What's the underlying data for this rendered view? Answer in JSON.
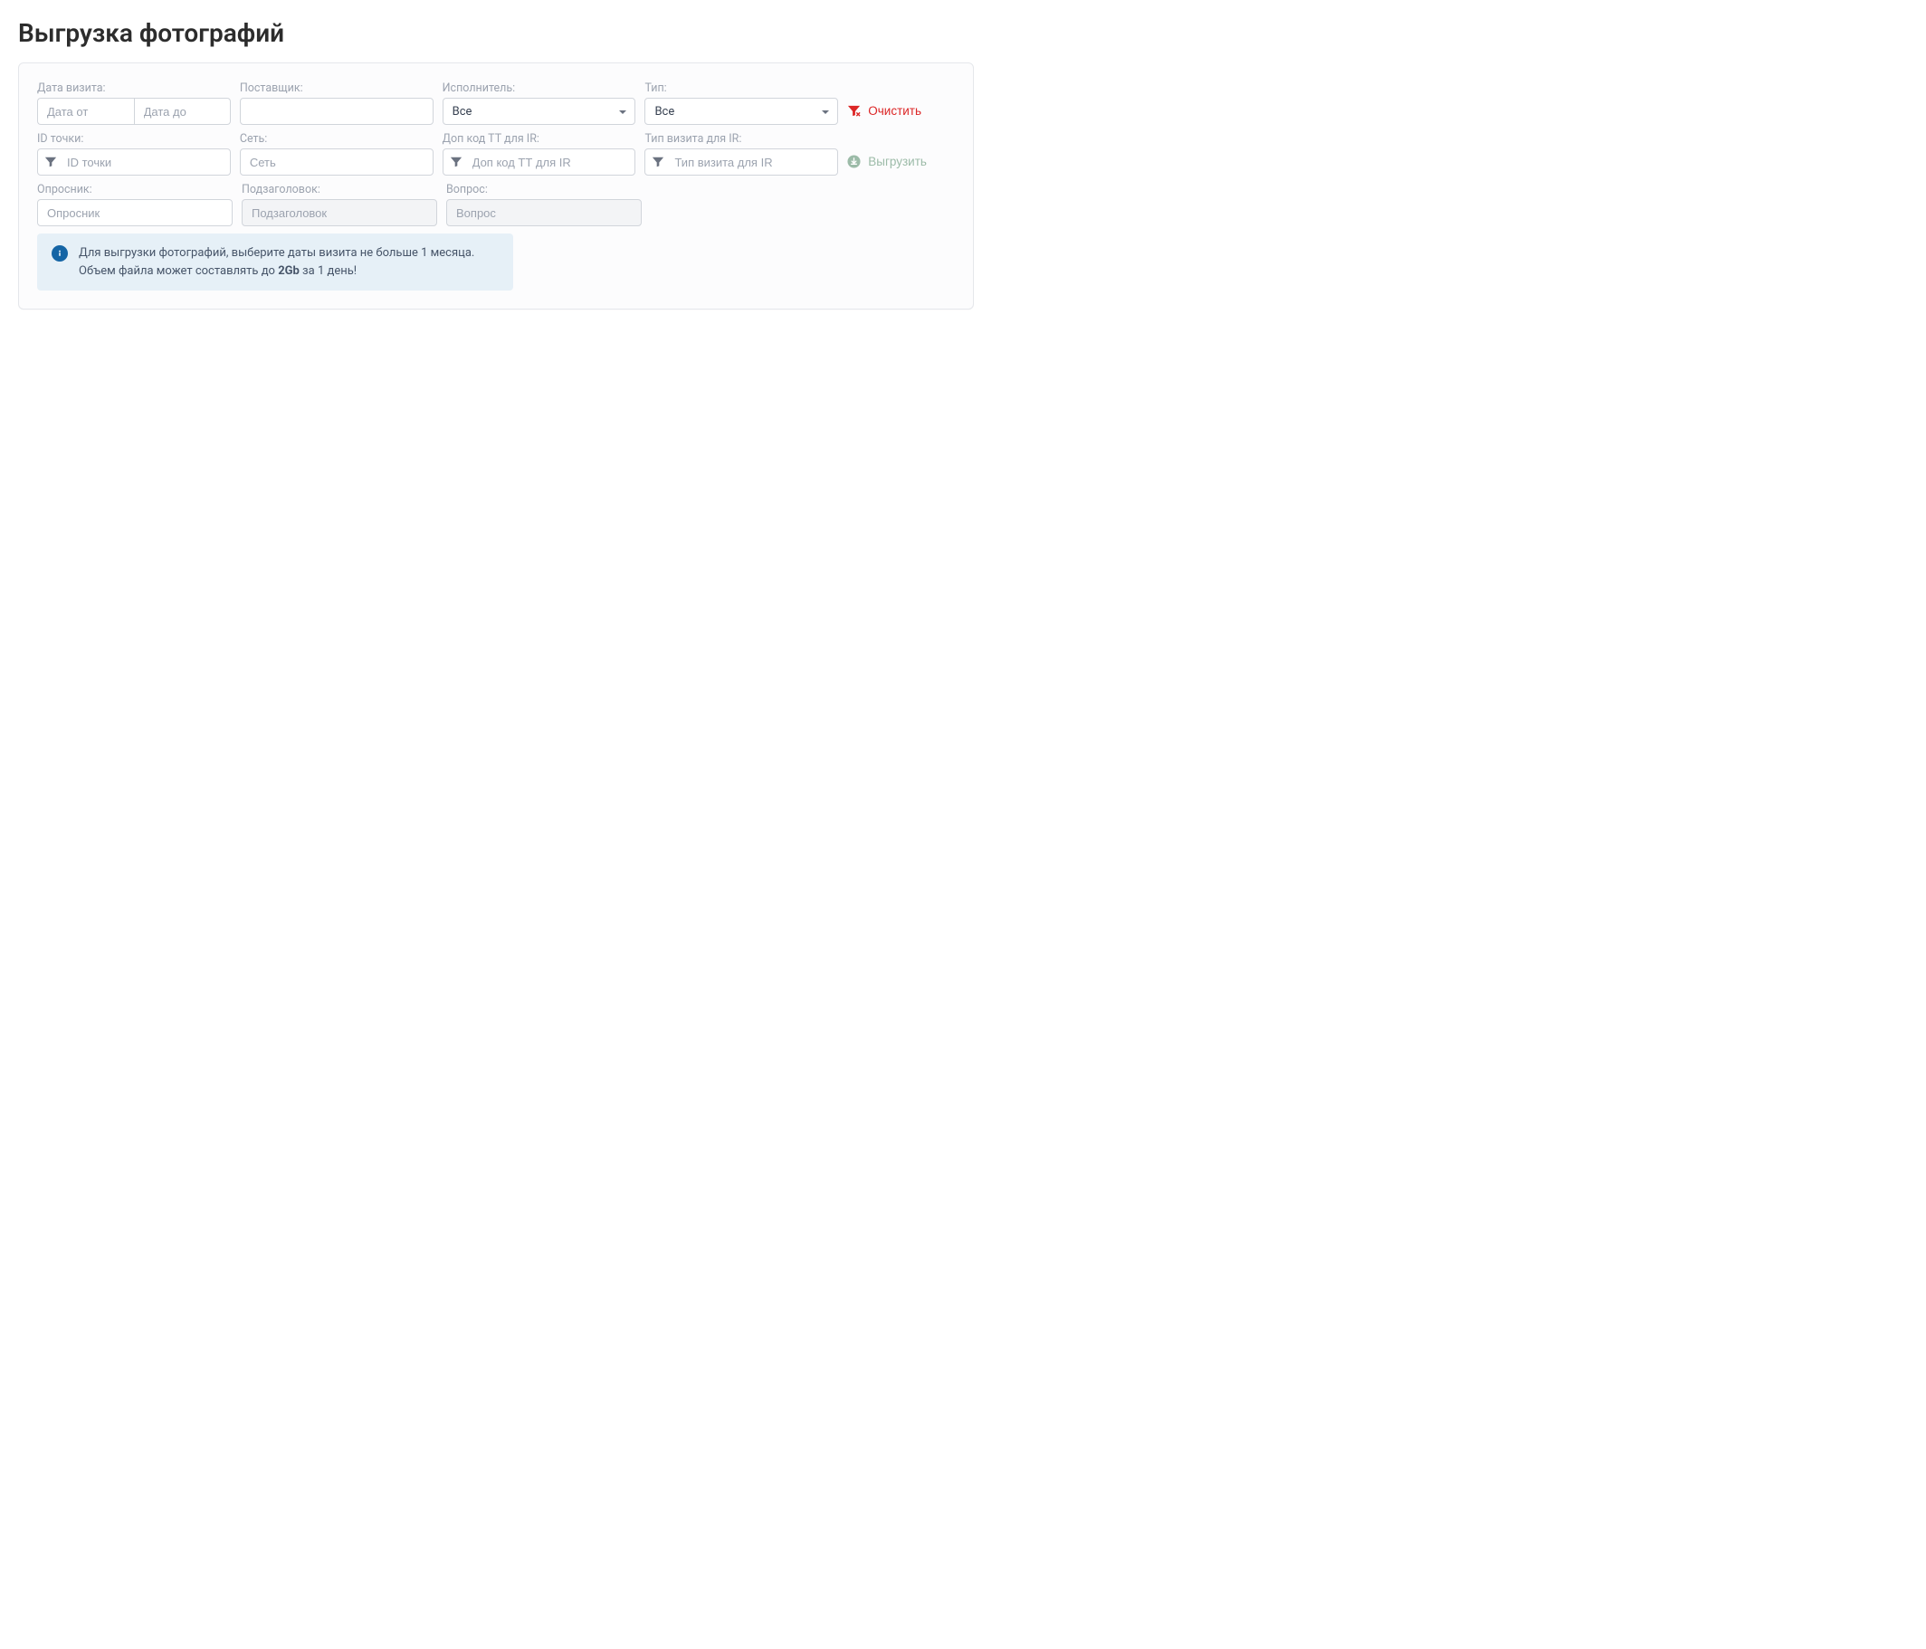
{
  "page_title": "Выгрузка фотографий",
  "row1": {
    "visit_date": {
      "label": "Дата визита:",
      "from_placeholder": "Дата от",
      "to_placeholder": "Дата до"
    },
    "supplier": {
      "label": "Поставщик:"
    },
    "executor": {
      "label": "Исполнитель:",
      "value": "Все"
    },
    "type": {
      "label": "Тип:",
      "value": "Все"
    },
    "clear_btn": "Очистить"
  },
  "row2": {
    "point_id": {
      "label": "ID точки:",
      "placeholder": "ID точки"
    },
    "network": {
      "label": "Сеть:",
      "placeholder": "Сеть"
    },
    "ir_code": {
      "label": "Доп код ТТ для IR:",
      "placeholder": "Доп код ТТ для IR"
    },
    "ir_visit_type": {
      "label": "Тип визита для IR:",
      "placeholder": "Тип визита для IR"
    },
    "export_btn": "Выгрузить"
  },
  "row3": {
    "questionnaire": {
      "label": "Опросник:",
      "placeholder": "Опросник"
    },
    "subtitle": {
      "label": "Подзаголовок:",
      "placeholder": "Подзаголовок"
    },
    "question": {
      "label": "Вопрос:",
      "placeholder": "Вопрос"
    }
  },
  "info": {
    "line1": "Для выгрузки фотографий, выберите даты визита не больше 1 месяца.",
    "line2_prefix": "Объем файла может составлять до ",
    "line2_bold": "2Gb",
    "line2_suffix": " за 1 день!"
  }
}
